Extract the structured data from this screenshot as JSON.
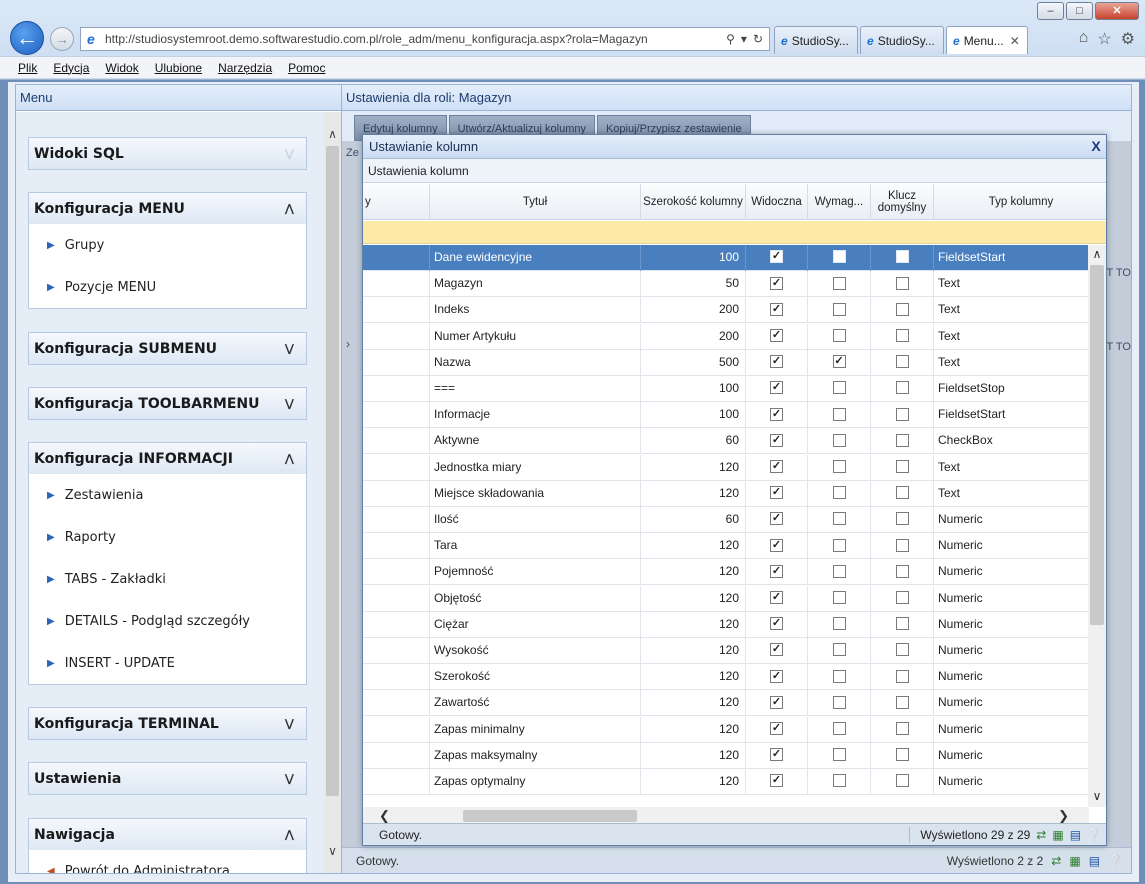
{
  "browser": {
    "window_buttons": [
      "–",
      "□",
      "✕"
    ],
    "url": "http://studiosystemroot.demo.softwarestudio.com.pl/role_adm/menu_konfiguracja.aspx?rola=Magazyn",
    "tabs": [
      {
        "label": "StudioSy..."
      },
      {
        "label": "StudioSy..."
      },
      {
        "label": "Menu..."
      }
    ],
    "menu": [
      "Plik",
      "Edycja",
      "Widok",
      "Ulubione",
      "Narzędzia",
      "Pomoc"
    ]
  },
  "left_panel": {
    "title": "Menu",
    "sections": [
      {
        "title": "Widoki SQL",
        "items": []
      },
      {
        "title": "Konfiguracja MENU",
        "items": [
          "Grupy",
          "Pozycje MENU"
        ]
      },
      {
        "title": "Konfiguracja SUBMENU",
        "items": []
      },
      {
        "title": "Konfiguracja TOOLBARMENU",
        "items": []
      },
      {
        "title": "Konfiguracja INFORMACJI",
        "items": [
          "Zestawienia",
          "Raporty",
          "TABS - Zakładki",
          "DETAILS - Podgląd szczegóły",
          "INSERT - UPDATE"
        ]
      },
      {
        "title": "Konfiguracja TERMINAL",
        "items": []
      },
      {
        "title": "Ustawienia",
        "items": []
      },
      {
        "title": "Nawigacja",
        "items": [
          "Powrót do Administratora"
        ]
      }
    ]
  },
  "right_panel": {
    "title": "Ustawienia dla roli: Magazyn",
    "toolbar": [
      "Edytuj kolumny",
      "Utwórz/Aktualizuj kolumny",
      "Kopiuj/Przypisz zestawienie"
    ],
    "status_left": "Gotowy.",
    "status_right": "Wyświetlono 2 z 2",
    "peek_labels": [
      "Ze",
      "T TO",
      "T TO"
    ]
  },
  "dialog": {
    "title": "Ustawianie kolumn",
    "close": "X",
    "subheader": "Ustawienia kolumn",
    "columns": [
      "y",
      "Tytuł",
      "Szerokość kolumny",
      "Widoczna",
      "Wymag...",
      "Klucz domyślny",
      "Typ kolumny"
    ],
    "rows": [
      {
        "title": "Dane ewidencyjne",
        "width": "100",
        "visible": true,
        "required": false,
        "key": false,
        "type": "FieldsetStart"
      },
      {
        "title": "Magazyn",
        "width": "50",
        "visible": true,
        "required": false,
        "key": false,
        "type": "Text"
      },
      {
        "title": "Indeks",
        "width": "200",
        "visible": true,
        "required": false,
        "key": false,
        "type": "Text"
      },
      {
        "title": "Numer Artykułu",
        "width": "200",
        "visible": true,
        "required": false,
        "key": false,
        "type": "Text"
      },
      {
        "title": "Nazwa",
        "width": "500",
        "visible": true,
        "required": true,
        "key": false,
        "type": "Text"
      },
      {
        "title": "===",
        "width": "100",
        "visible": true,
        "required": false,
        "key": false,
        "type": "FieldsetStop"
      },
      {
        "title": "Informacje",
        "width": "100",
        "visible": true,
        "required": false,
        "key": false,
        "type": "FieldsetStart"
      },
      {
        "title": "Aktywne",
        "width": "60",
        "visible": true,
        "required": false,
        "key": false,
        "type": "CheckBox"
      },
      {
        "title": "Jednostka miary",
        "width": "120",
        "visible": true,
        "required": false,
        "key": false,
        "type": "Text"
      },
      {
        "title": "Miejsce składowania",
        "width": "120",
        "visible": true,
        "required": false,
        "key": false,
        "type": "Text"
      },
      {
        "title": "Ilość",
        "width": "60",
        "visible": true,
        "required": false,
        "key": false,
        "type": "Numeric"
      },
      {
        "title": "Tara",
        "width": "120",
        "visible": true,
        "required": false,
        "key": false,
        "type": "Numeric"
      },
      {
        "title": "Pojemność",
        "width": "120",
        "visible": true,
        "required": false,
        "key": false,
        "type": "Numeric"
      },
      {
        "title": "Objętość",
        "width": "120",
        "visible": true,
        "required": false,
        "key": false,
        "type": "Numeric"
      },
      {
        "title": "Ciężar",
        "width": "120",
        "visible": true,
        "required": false,
        "key": false,
        "type": "Numeric"
      },
      {
        "title": "Wysokość",
        "width": "120",
        "visible": true,
        "required": false,
        "key": false,
        "type": "Numeric"
      },
      {
        "title": "Szerokość",
        "width": "120",
        "visible": true,
        "required": false,
        "key": false,
        "type": "Numeric"
      },
      {
        "title": "Zawartość",
        "width": "120",
        "visible": true,
        "required": false,
        "key": false,
        "type": "Numeric"
      },
      {
        "title": "Zapas minimalny",
        "width": "120",
        "visible": true,
        "required": false,
        "key": false,
        "type": "Numeric"
      },
      {
        "title": "Zapas maksymalny",
        "width": "120",
        "visible": true,
        "required": false,
        "key": false,
        "type": "Numeric"
      },
      {
        "title": "Zapas optymalny",
        "width": "120",
        "visible": true,
        "required": false,
        "key": false,
        "type": "Numeric"
      }
    ],
    "selected_row": 0,
    "status_left": "Gotowy.",
    "status_right": "Wyświetlono 29 z 29"
  }
}
